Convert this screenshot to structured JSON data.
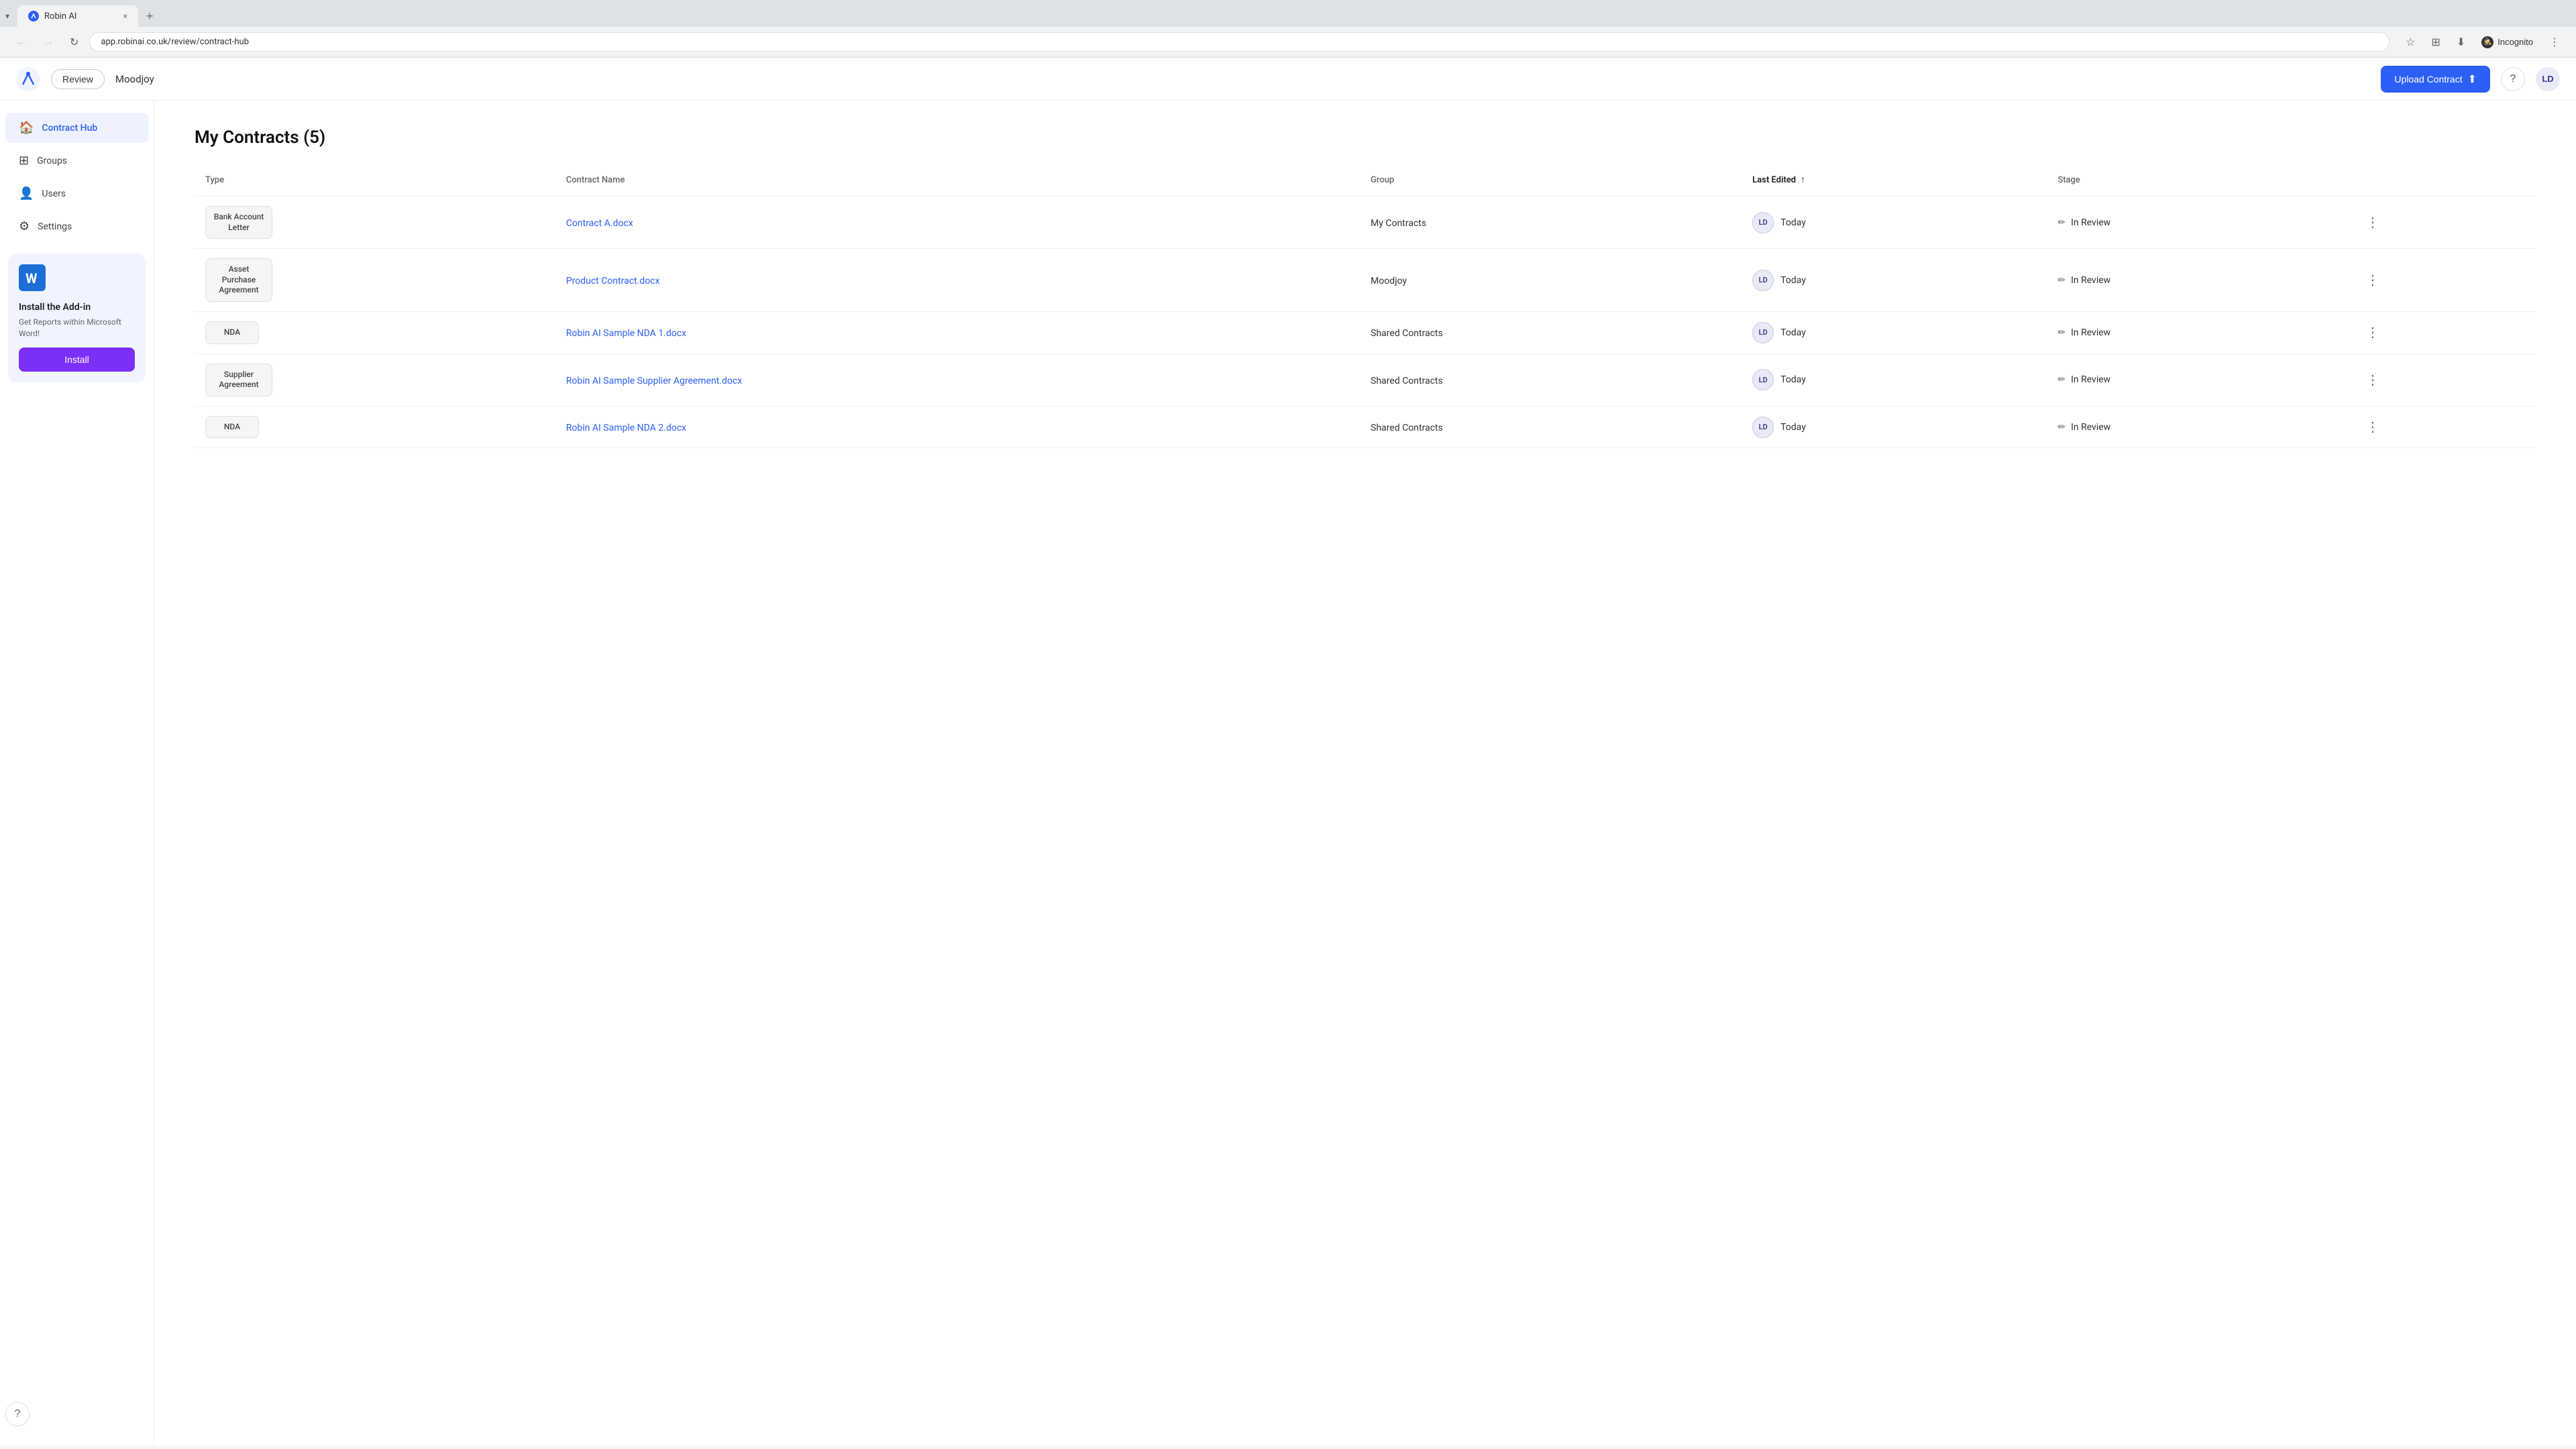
{
  "browser": {
    "tab_label": "Robin AI",
    "tab_close": "×",
    "tab_new": "+",
    "tab_dropdown": "▾",
    "nav_back": "←",
    "nav_forward": "→",
    "nav_reload": "↻",
    "address_url": "app.robinai.co.uk/review/contract-hub",
    "bookmark_icon": "☆",
    "extensions_icon": "⊞",
    "download_icon": "⬇",
    "incognito_label": "Incognito",
    "menu_icon": "⋮"
  },
  "header": {
    "review_btn": "Review",
    "org_name": "Moodjoy",
    "upload_btn": "Upload Contract",
    "avatar_initials": "LD"
  },
  "sidebar": {
    "items": [
      {
        "id": "contract-hub",
        "label": "Contract Hub",
        "icon": "🏠",
        "active": true
      },
      {
        "id": "groups",
        "label": "Groups",
        "icon": "⊞",
        "active": false
      },
      {
        "id": "users",
        "label": "Users",
        "icon": "👤",
        "active": false
      },
      {
        "id": "settings",
        "label": "Settings",
        "icon": "⚙",
        "active": false
      }
    ],
    "addon": {
      "title": "Install the Add-in",
      "description": "Get Reports within Microsoft Word!",
      "install_btn": "Install"
    }
  },
  "main": {
    "page_title": "My Contracts (5)",
    "table": {
      "columns": [
        {
          "id": "type",
          "label": "Type"
        },
        {
          "id": "contract_name",
          "label": "Contract Name"
        },
        {
          "id": "group",
          "label": "Group"
        },
        {
          "id": "last_edited",
          "label": "Last Edited",
          "sorted": true
        },
        {
          "id": "stage",
          "label": "Stage"
        }
      ],
      "rows": [
        {
          "type": "Bank Account Letter",
          "contract_name": "Contract A.docx",
          "group": "My Contracts",
          "avatar": "LD",
          "last_edited": "Today",
          "stage": "In Review"
        },
        {
          "type": "Asset Purchase Agreement",
          "contract_name": "Product Contract.docx",
          "group": "Moodjoy",
          "avatar": "LD",
          "last_edited": "Today",
          "stage": "In Review"
        },
        {
          "type": "NDA",
          "contract_name": "Robin AI Sample NDA 1.docx",
          "group": "Shared Contracts",
          "avatar": "LD",
          "last_edited": "Today",
          "stage": "In Review"
        },
        {
          "type": "Supplier Agreement",
          "contract_name": "Robin AI Sample Supplier Agreement.docx",
          "group": "Shared Contracts",
          "avatar": "LD",
          "last_edited": "Today",
          "stage": "In Review"
        },
        {
          "type": "NDA",
          "contract_name": "Robin AI Sample NDA 2.docx",
          "group": "Shared Contracts",
          "avatar": "LD",
          "last_edited": "Today",
          "stage": "In Review"
        }
      ]
    }
  },
  "colors": {
    "accent": "#2c5ff6",
    "sidebar_active_bg": "#eef2ff",
    "install_btn_bg": "#7b2ff7"
  }
}
